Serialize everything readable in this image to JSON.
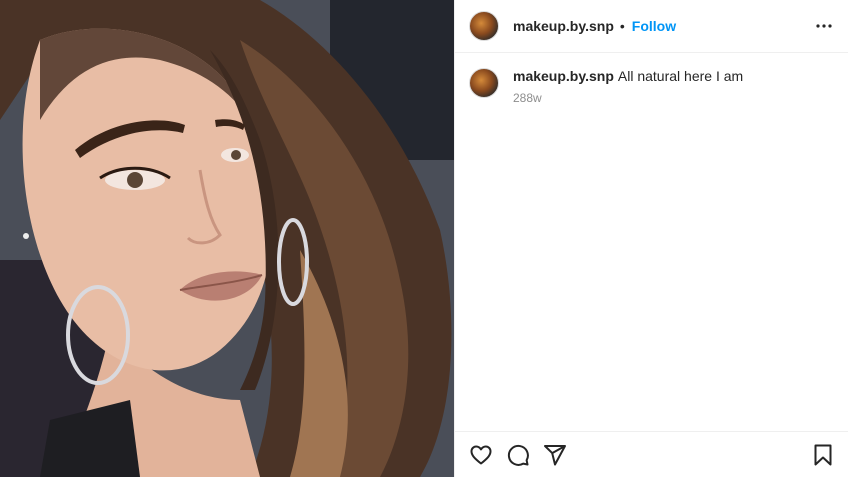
{
  "header": {
    "username": "makeup.by.snp",
    "separator": "•",
    "follow_label": "Follow",
    "more_icon": "more-horizontal-icon"
  },
  "caption": {
    "username": "makeup.by.snp",
    "text": "All natural here I am",
    "timestamp": "288w"
  },
  "actions": {
    "like_icon": "heart-icon",
    "comment_icon": "comment-icon",
    "share_icon": "share-icon",
    "save_icon": "bookmark-icon"
  },
  "colors": {
    "follow": "#0095f6",
    "text": "#262626",
    "muted": "#8e8e8e",
    "divider": "#efefef"
  }
}
